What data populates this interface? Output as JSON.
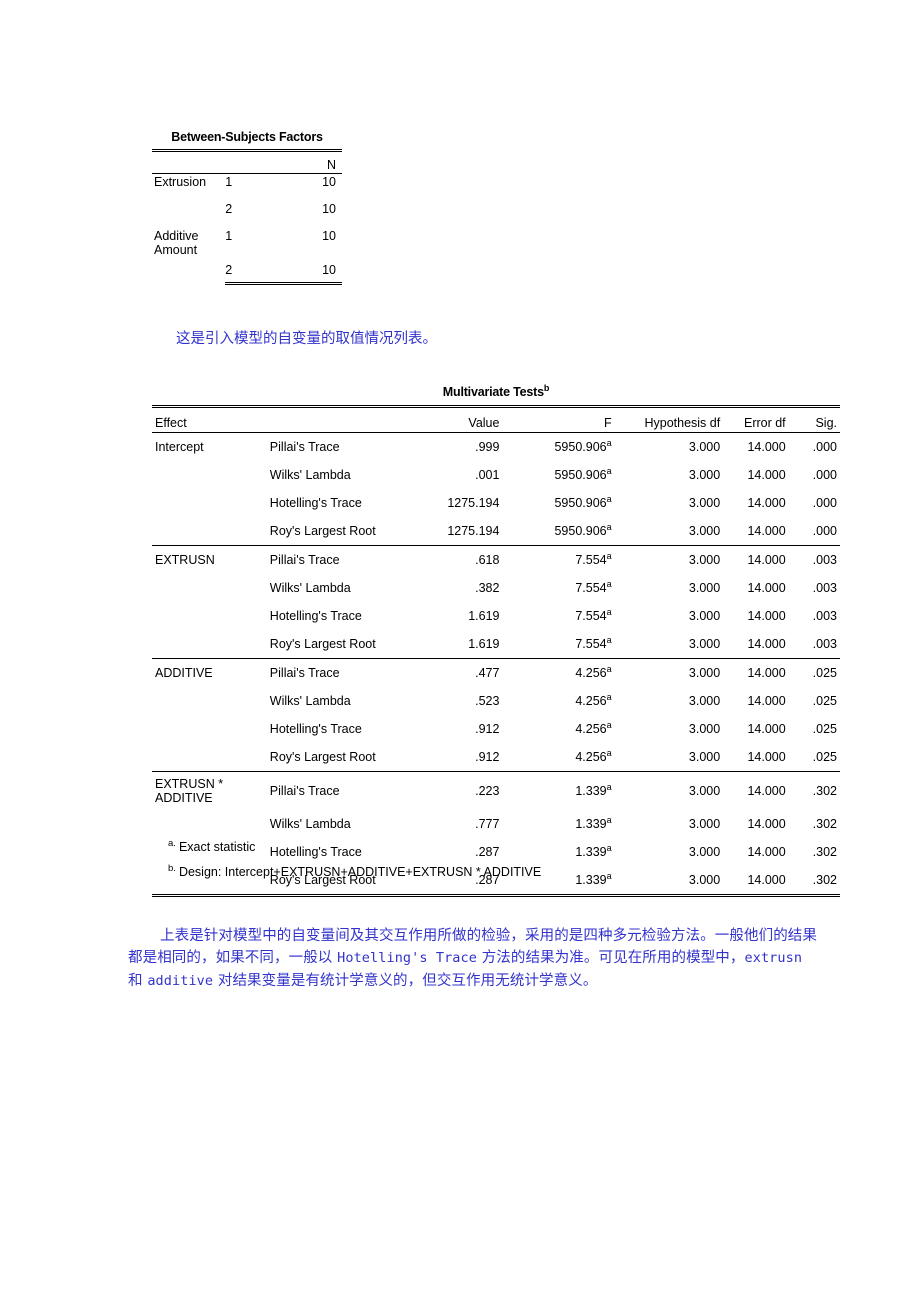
{
  "table1": {
    "title": "Between-Subjects Factors",
    "columns": [
      "",
      "",
      "N"
    ],
    "rows": [
      {
        "factor": "Extrusion",
        "level": "1",
        "n": "10"
      },
      {
        "factor": "",
        "level": "2",
        "n": "10"
      },
      {
        "factor": "Additive Amount",
        "level": "1",
        "n": "10"
      },
      {
        "factor": "",
        "level": "2",
        "n": "10"
      }
    ]
  },
  "note1": "这是引入模型的自变量的取值情况列表。",
  "table2": {
    "title": "Multivariate Tests",
    "title_superscript": "b",
    "columns": {
      "effect": "Effect",
      "test": "",
      "value": "Value",
      "f": "F",
      "hypothesis_df": "Hypothesis df",
      "error_df": "Error df",
      "sig": "Sig."
    },
    "groups": [
      {
        "effect": "Intercept",
        "rows": [
          {
            "test": "Pillai's Trace",
            "value": ".999",
            "f": "5950.906",
            "f_sup": "a",
            "hyp_df": "3.000",
            "err_df": "14.000",
            "sig": ".000"
          },
          {
            "test": "Wilks' Lambda",
            "value": ".001",
            "f": "5950.906",
            "f_sup": "a",
            "hyp_df": "3.000",
            "err_df": "14.000",
            "sig": ".000"
          },
          {
            "test": "Hotelling's Trace",
            "value": "1275.194",
            "f": "5950.906",
            "f_sup": "a",
            "hyp_df": "3.000",
            "err_df": "14.000",
            "sig": ".000"
          },
          {
            "test": "Roy's Largest Root",
            "value": "1275.194",
            "f": "5950.906",
            "f_sup": "a",
            "hyp_df": "3.000",
            "err_df": "14.000",
            "sig": ".000"
          }
        ]
      },
      {
        "effect": "EXTRUSN",
        "rows": [
          {
            "test": "Pillai's Trace",
            "value": ".618",
            "f": "7.554",
            "f_sup": "a",
            "hyp_df": "3.000",
            "err_df": "14.000",
            "sig": ".003"
          },
          {
            "test": "Wilks' Lambda",
            "value": ".382",
            "f": "7.554",
            "f_sup": "a",
            "hyp_df": "3.000",
            "err_df": "14.000",
            "sig": ".003"
          },
          {
            "test": "Hotelling's Trace",
            "value": "1.619",
            "f": "7.554",
            "f_sup": "a",
            "hyp_df": "3.000",
            "err_df": "14.000",
            "sig": ".003"
          },
          {
            "test": "Roy's Largest Root",
            "value": "1.619",
            "f": "7.554",
            "f_sup": "a",
            "hyp_df": "3.000",
            "err_df": "14.000",
            "sig": ".003"
          }
        ]
      },
      {
        "effect": "ADDITIVE",
        "rows": [
          {
            "test": "Pillai's Trace",
            "value": ".477",
            "f": "4.256",
            "f_sup": "a",
            "hyp_df": "3.000",
            "err_df": "14.000",
            "sig": ".025"
          },
          {
            "test": "Wilks' Lambda",
            "value": ".523",
            "f": "4.256",
            "f_sup": "a",
            "hyp_df": "3.000",
            "err_df": "14.000",
            "sig": ".025"
          },
          {
            "test": "Hotelling's Trace",
            "value": ".912",
            "f": "4.256",
            "f_sup": "a",
            "hyp_df": "3.000",
            "err_df": "14.000",
            "sig": ".025"
          },
          {
            "test": "Roy's Largest Root",
            "value": ".912",
            "f": "4.256",
            "f_sup": "a",
            "hyp_df": "3.000",
            "err_df": "14.000",
            "sig": ".025"
          }
        ]
      },
      {
        "effect": "EXTRUSN * ADDITIVE",
        "rows": [
          {
            "test": "Pillai's Trace",
            "value": ".223",
            "f": "1.339",
            "f_sup": "a",
            "hyp_df": "3.000",
            "err_df": "14.000",
            "sig": ".302"
          },
          {
            "test": "Wilks' Lambda",
            "value": ".777",
            "f": "1.339",
            "f_sup": "a",
            "hyp_df": "3.000",
            "err_df": "14.000",
            "sig": ".302"
          },
          {
            "test": "Hotelling's Trace",
            "value": ".287",
            "f": "1.339",
            "f_sup": "a",
            "hyp_df": "3.000",
            "err_df": "14.000",
            "sig": ".302"
          },
          {
            "test": "Roy's Largest Root",
            "value": ".287",
            "f": "1.339",
            "f_sup": "a",
            "hyp_df": "3.000",
            "err_df": "14.000",
            "sig": ".302"
          }
        ]
      }
    ],
    "footnotes": [
      {
        "mark": "a.",
        "text": "Exact statistic"
      },
      {
        "mark": "b.",
        "text": "Design: Intercept+EXTRUSN+ADDITIVE+EXTRUSN * ADDITIVE"
      }
    ]
  },
  "note2": {
    "seg1": "上表是针对模型中的自变量间及其交互作用所做的检验，采用的是四种多元检验方法。一般他们的结果都是相同的，如果不同，一般以 ",
    "mono1": "Hotelling's Trace",
    "seg2": " 方法的结果为准。可见在所用的模型中，",
    "mono2": "extrusn",
    "seg3": " 和 ",
    "mono3": "additive",
    "seg4": " 对结果变量是有统计学意义的，但交互作用无统计学意义。"
  },
  "colors": {
    "note_blue": "#3333cc",
    "rule": "#000000",
    "page_bg": "#ffffff"
  }
}
